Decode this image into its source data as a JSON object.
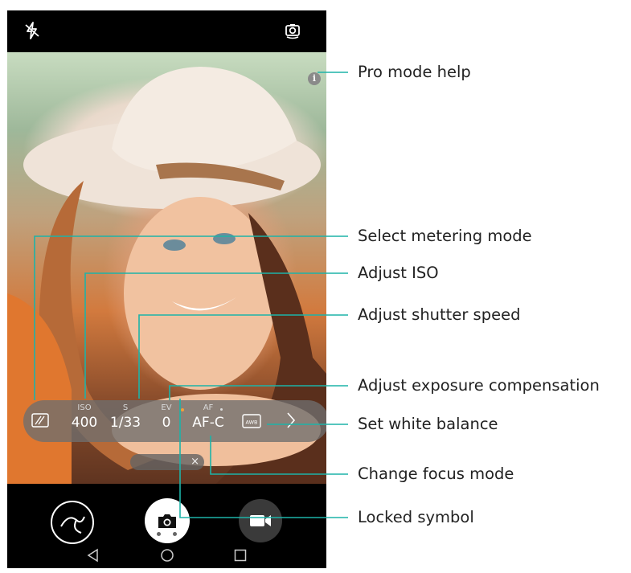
{
  "pro_bar": {
    "iso": {
      "label": "ISO",
      "value": "400"
    },
    "shutter": {
      "label": "S",
      "value": "1/33"
    },
    "ev": {
      "label": "EV",
      "value": "0"
    },
    "af": {
      "label": "AF",
      "value": "AF-C"
    },
    "awb_text": "AWB"
  },
  "info_icon_text": "i",
  "pill_close": "×",
  "annotations": {
    "pro_mode_help": "Pro mode help",
    "select_metering_mode": "Select metering mode",
    "adjust_iso": "Adjust ISO",
    "adjust_shutter_speed": "Adjust shutter speed",
    "adjust_exposure_compensation": "Adjust exposure compensation",
    "set_white_balance": "Set white balance",
    "change_focus_mode": "Change focus mode",
    "locked_symbol": "Locked symbol"
  },
  "icons": {
    "flash": "flash-off-icon",
    "switch_camera": "switch-camera-icon",
    "metering": "metering-icon",
    "awb": "awb-icon",
    "more": "chevron-right-icon",
    "gallery": "gallery-icon",
    "shutter": "camera-shutter-icon",
    "video": "video-icon",
    "back": "nav-back-icon",
    "home": "nav-home-icon",
    "recents": "nav-recents-icon"
  },
  "colors": {
    "annotation_line": "#1db3a8",
    "lock_dot": "#f2a03a"
  }
}
